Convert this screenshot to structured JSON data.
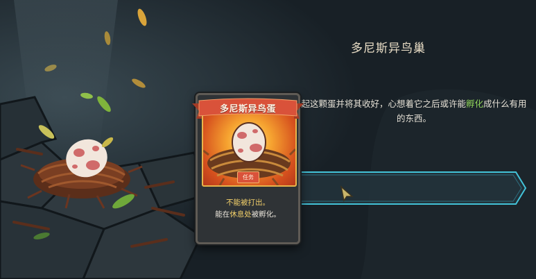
{
  "item": {
    "title": "多尼斯异鸟巢",
    "description_pre": "起这颗蛋并将其收好，心想着它之后或许能",
    "description_highlight": "孵化",
    "description_post": "成什么有用的东西。"
  },
  "card": {
    "name": "多尼斯异鸟蛋",
    "tag": "任务",
    "line1": "不能被打出。",
    "line2_pre": "能在",
    "line2_highlight": "休息处",
    "line2_post": "被孵化。"
  },
  "colors": {
    "highlight_green": "#8fd35a",
    "highlight_yellow": "#f3d06a",
    "bar_outline": "#43c3d9",
    "banner_red": "#d9523a"
  }
}
